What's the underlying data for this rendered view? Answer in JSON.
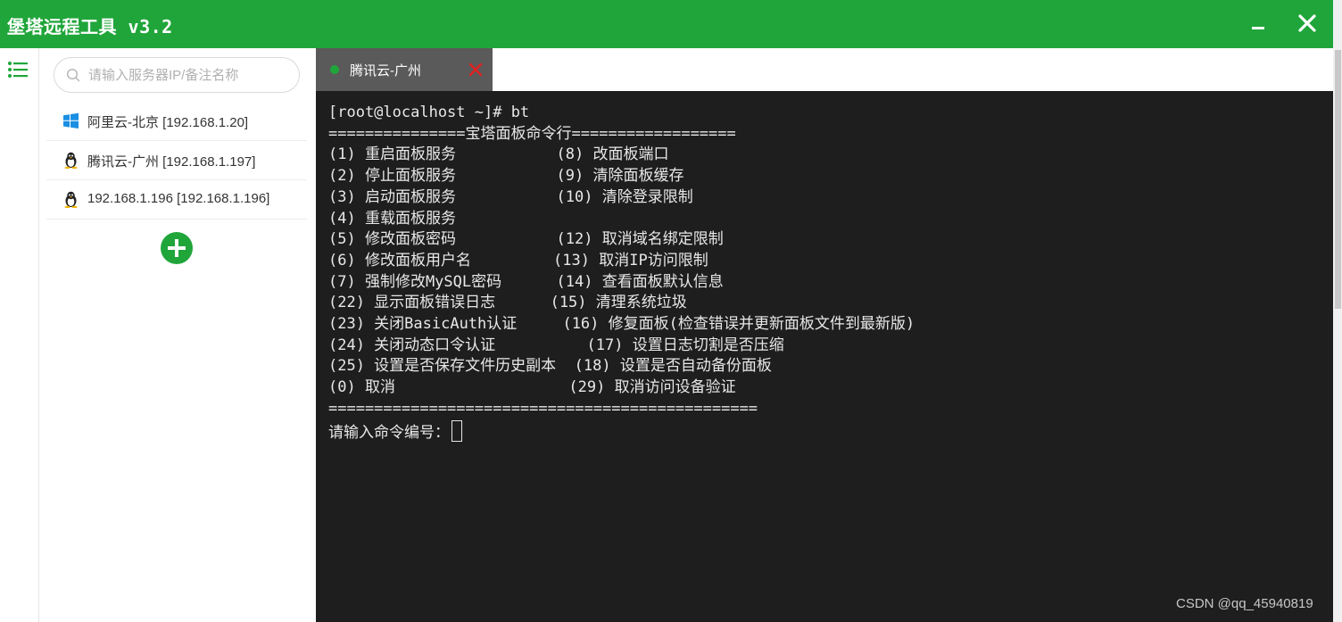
{
  "window": {
    "title": "堡塔远程工具 v3.2",
    "colors": {
      "accent": "#20a53a",
      "terminal_bg": "#1e1e1e",
      "tab_bg": "#5a5a5a",
      "close_tab": "#e02020"
    }
  },
  "sidebar": {
    "search_placeholder": "请输入服务器IP/备注名称",
    "servers": [
      {
        "os": "windows-icon",
        "label": "阿里云-北京 [192.168.1.20]"
      },
      {
        "os": "linux-penguin-icon",
        "label": "腾讯云-广州 [192.168.1.197]"
      },
      {
        "os": "linux-penguin-icon",
        "label": "192.168.1.196 [192.168.1.196]"
      }
    ]
  },
  "tabs": [
    {
      "label": "腾讯云-广州",
      "status": "connected"
    }
  ],
  "terminal": {
    "lines": [
      "[root@localhost ~]# bt",
      "===============宝塔面板命令行==================",
      "(1) 重启面板服务           (8) 改面板端口",
      "(2) 停止面板服务           (9) 清除面板缓存",
      "(3) 启动面板服务           (10) 清除登录限制",
      "(4) 重载面板服务",
      "(5) 修改面板密码           (12) 取消域名绑定限制",
      "(6) 修改面板用户名         (13) 取消IP访问限制",
      "(7) 强制修改MySQL密码      (14) 查看面板默认信息",
      "(22) 显示面板错误日志      (15) 清理系统垃圾",
      "(23) 关闭BasicAuth认证     (16) 修复面板(检查错误并更新面板文件到最新版)",
      "(24) 关闭动态口令认证          (17) 设置日志切割是否压缩",
      "(25) 设置是否保存文件历史副本  (18) 设置是否自动备份面板",
      "(0) 取消                   (29) 取消访问设备验证",
      "==============================================="
    ],
    "prompt": "请输入命令编号："
  },
  "watermark": "CSDN @qq_45940819"
}
